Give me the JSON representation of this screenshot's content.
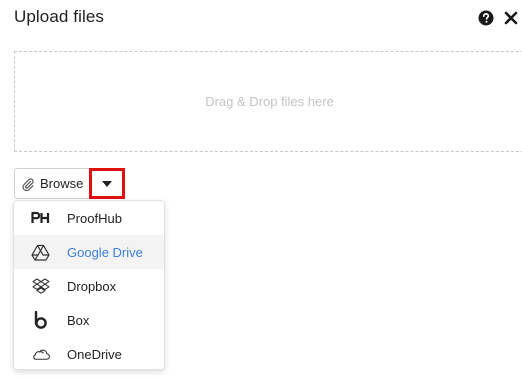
{
  "dialog": {
    "title": "Upload files",
    "help_icon": "question-circle-icon",
    "close_icon": "close-icon"
  },
  "dropzone": {
    "text": "Drag & Drop files here"
  },
  "browse": {
    "label": "Browse",
    "icon": "paperclip-icon",
    "toggle_icon": "caret-down-icon",
    "toggle_highlight_color": "#e01010"
  },
  "menu": {
    "items": [
      {
        "label": "ProofHub",
        "icon": "proofhub-icon",
        "active": false
      },
      {
        "label": "Google Drive",
        "icon": "google-drive-icon",
        "active": true
      },
      {
        "label": "Dropbox",
        "icon": "dropbox-icon",
        "active": false
      },
      {
        "label": "Box",
        "icon": "box-icon",
        "active": false
      },
      {
        "label": "OneDrive",
        "icon": "onedrive-icon",
        "active": false
      }
    ],
    "active_color": "#3b7fdb"
  }
}
